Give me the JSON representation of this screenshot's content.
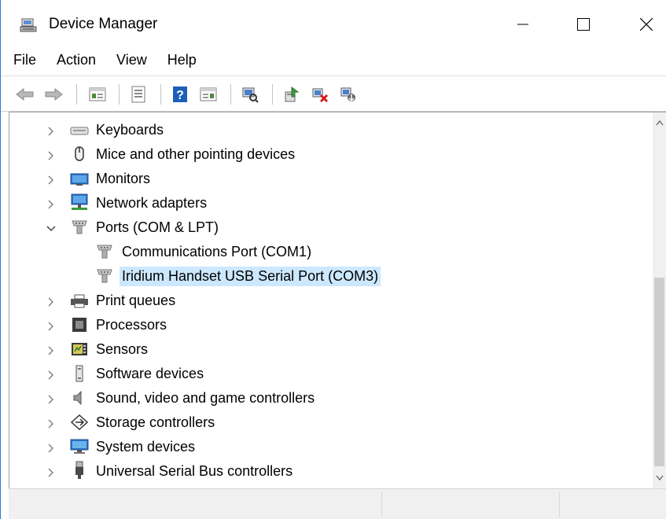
{
  "window": {
    "title": "Device Manager",
    "icon": "device-manager-icon",
    "controls": [
      "minimize-icon",
      "maximize-icon",
      "close-icon"
    ]
  },
  "menu": {
    "items": [
      "File",
      "Action",
      "View",
      "Help"
    ]
  },
  "toolbar": {
    "buttons": [
      "back-icon",
      "forward-icon",
      "properties-pane-icon",
      "properties-icon",
      "help-icon",
      "view-icon",
      "scan-hardware-icon",
      "update-driver-icon",
      "uninstall-device-icon",
      "add-legacy-hardware-icon"
    ]
  },
  "tree": {
    "items": [
      {
        "label": "Keyboards",
        "icon": "keyboard-icon",
        "expanded": false
      },
      {
        "label": "Mice and other pointing devices",
        "icon": "mouse-icon",
        "expanded": false
      },
      {
        "label": "Monitors",
        "icon": "monitor-icon",
        "expanded": false
      },
      {
        "label": "Network adapters",
        "icon": "network-adapter-icon",
        "expanded": false
      },
      {
        "label": "Ports (COM & LPT)",
        "icon": "port-icon",
        "expanded": true
      },
      {
        "label": "Communications Port (COM1)",
        "icon": "port-icon",
        "child": true
      },
      {
        "label": "Iridium Handset USB Serial Port (COM3)",
        "icon": "port-icon",
        "child": true,
        "selected": true
      },
      {
        "label": "Print queues",
        "icon": "printer-icon",
        "expanded": false
      },
      {
        "label": "Processors",
        "icon": "processor-icon",
        "expanded": false
      },
      {
        "label": "Sensors",
        "icon": "sensor-icon",
        "expanded": false
      },
      {
        "label": "Software devices",
        "icon": "software-device-icon",
        "expanded": false
      },
      {
        "label": "Sound, video and game controllers",
        "icon": "speaker-icon",
        "expanded": false
      },
      {
        "label": "Storage controllers",
        "icon": "storage-controller-icon",
        "expanded": false
      },
      {
        "label": "System devices",
        "icon": "system-device-icon",
        "expanded": false
      },
      {
        "label": "Universal Serial Bus controllers",
        "icon": "usb-icon",
        "expanded": false
      }
    ]
  },
  "colors": {
    "selection": "#cce8ff",
    "window_border": "#2b78d4"
  }
}
